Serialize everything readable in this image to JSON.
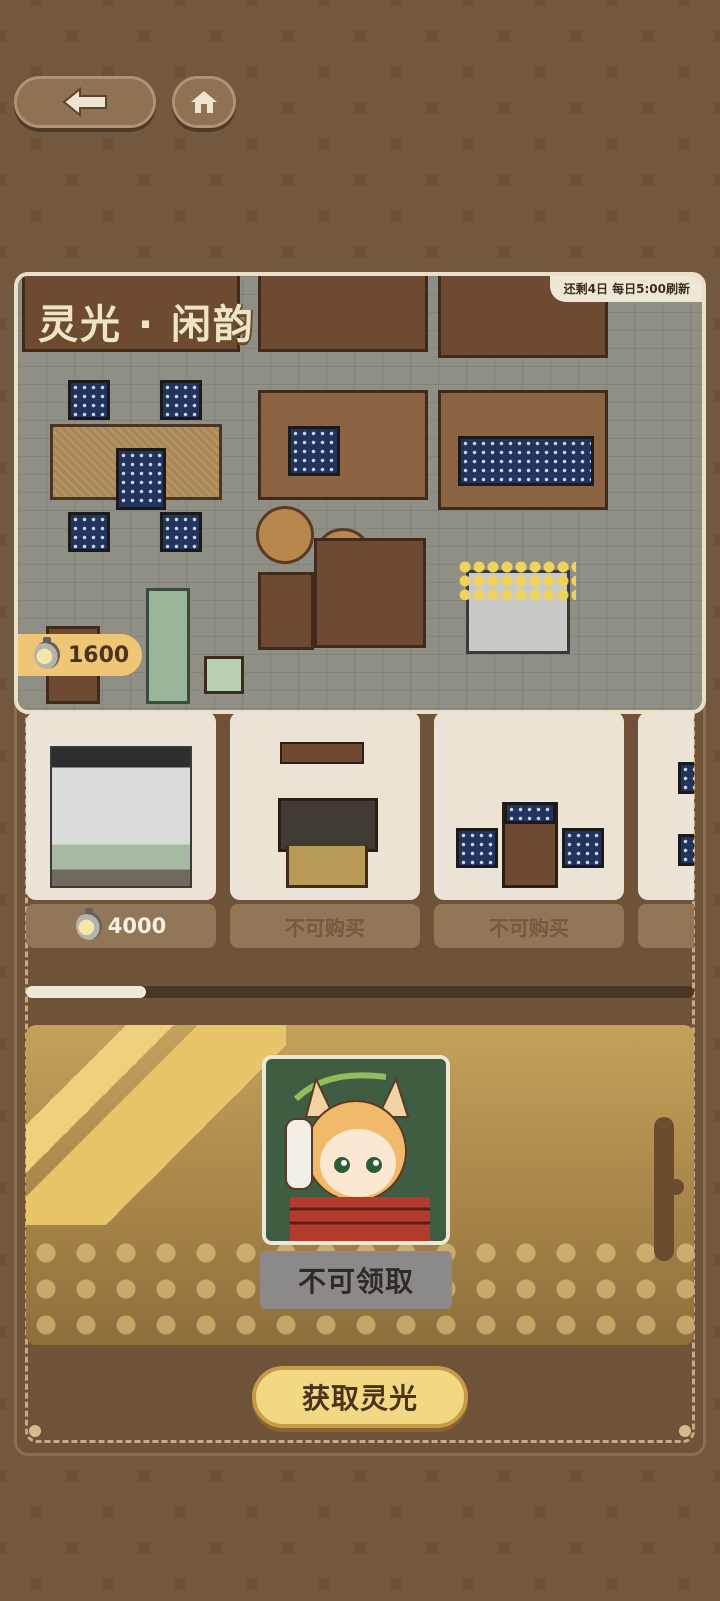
{
  "nav": {
    "back_icon": "arrow-left-icon",
    "home_icon": "home-icon"
  },
  "banner": {
    "title": "灵光 · 闲韵",
    "timer": "还剩4日 每日5:00刷新",
    "currency_amount": "1600",
    "currency_icon": "light-bottle-icon"
  },
  "shop": {
    "items": [
      {
        "name": "landscape-screen",
        "price_label": "4000",
        "purchasable": true
      },
      {
        "name": "tool-rack-desk",
        "price_label": "不可购买",
        "purchasable": false
      },
      {
        "name": "table-with-stools",
        "price_label": "不可购买",
        "purchasable": false
      },
      {
        "name": "partial-item",
        "price_label": "不",
        "purchasable": false
      }
    ],
    "scroll_progress": 0.18
  },
  "reward": {
    "claim_label": "不可领取"
  },
  "actions": {
    "get_light_label": "获取灵光"
  },
  "colors": {
    "accent_gold": "#f3d884",
    "panel_brown": "#6e5338",
    "coin_pill": "#efc676"
  }
}
